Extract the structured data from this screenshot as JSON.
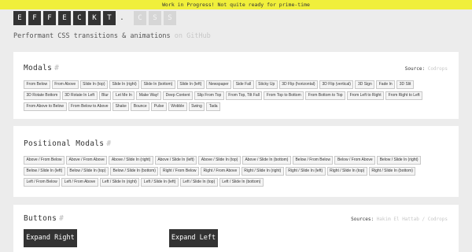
{
  "banner": "Work in Progress! Not quite ready for prime-time",
  "logo": [
    "E",
    "F",
    "F",
    "E",
    "C",
    "K",
    "T",
    ".",
    "C",
    "S",
    "S"
  ],
  "tagline": {
    "text": "Performant CSS transitions & animations",
    "link": "on GitHub"
  },
  "sections": {
    "modals": {
      "title": "Modals",
      "hash": "#",
      "source_label": "Source:",
      "source_link": "Codrops",
      "buttons": [
        "From Below",
        "From Above",
        "Slide In (top)",
        "Slide In (right)",
        "Slide In (bottom)",
        "Slide In (left)",
        "Newspaper",
        "Side Fall",
        "Sticky Up",
        "3D Flip (horizontal)",
        "3D Flip (vertical)",
        "3D Sign",
        "Fade In",
        "3D Slit",
        "3D Rotate Bottom",
        "3D Rotate In Left",
        "Blur",
        "Let Me In",
        "Make Way!",
        "Deep Content",
        "Slip From Top",
        "From Top, Tilt Fall",
        "From Top to Bottom",
        "From Bottom to Top",
        "From Left to Right",
        "From Right to Left",
        "From Above to Below",
        "From Below to Above",
        "Shake",
        "Bounce",
        "Pulse",
        "Wobble",
        "Swing",
        "Tada"
      ]
    },
    "positional": {
      "title": "Positional Modals",
      "hash": "#",
      "buttons": [
        "Above / From Below",
        "Above / From Above",
        "Above / Slide In (right)",
        "Above / Slide In (left)",
        "Above / Slide In (top)",
        "Above / Slide In (bottom)",
        "Below / From Below",
        "Below / From Above",
        "Below / Slide In (right)",
        "Below / Slide In (left)",
        "Below / Slide In (top)",
        "Below / Slide In (bottom)",
        "Right / From Below",
        "Right / From Above",
        "Right / Slide In (right)",
        "Right / Slide In (left)",
        "Right / Slide In (top)",
        "Right / Slide In (bottom)",
        "Left / From Below",
        "Left / From Above",
        "Left / Slide In (right)",
        "Left / Slide In (left)",
        "Left / Slide In (top)",
        "Left / Slide In (bottom)"
      ]
    },
    "buttons": {
      "title": "Buttons",
      "hash": "#",
      "source_label": "Sources:",
      "source_link": "Hakim El Hattab / Codrops",
      "items": [
        "Expand Right",
        "Expand Left"
      ]
    }
  },
  "colors": {
    "banner": "#f0ef3b",
    "accent_dark": "#333333",
    "link_muted": "#c7c7c7",
    "background": "#ececec"
  }
}
